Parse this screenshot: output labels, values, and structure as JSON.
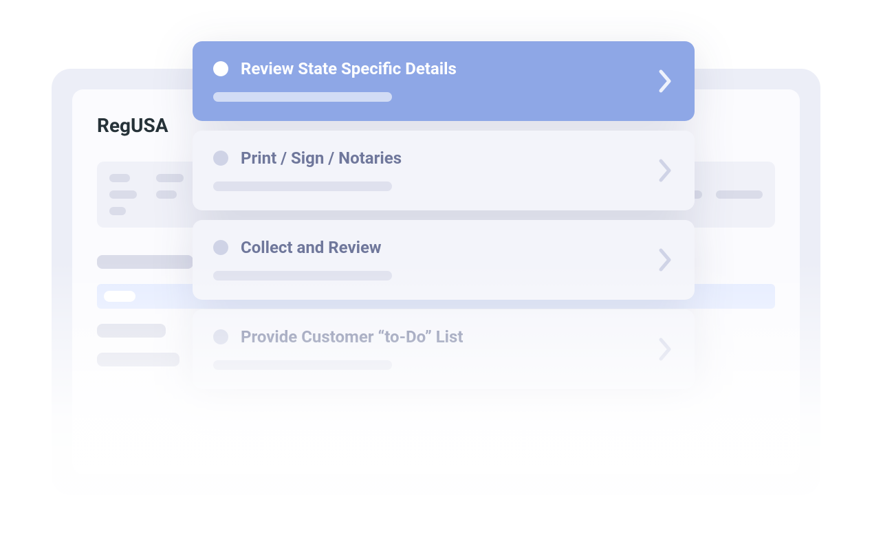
{
  "brand": "RegUSA",
  "steps": [
    {
      "title": "Review State Specific Details",
      "active": true
    },
    {
      "title": "Print / Sign / Notaries",
      "active": false
    },
    {
      "title": "Collect and Review",
      "active": false
    },
    {
      "title": "Provide Customer “to-Do” List",
      "active": false
    }
  ]
}
